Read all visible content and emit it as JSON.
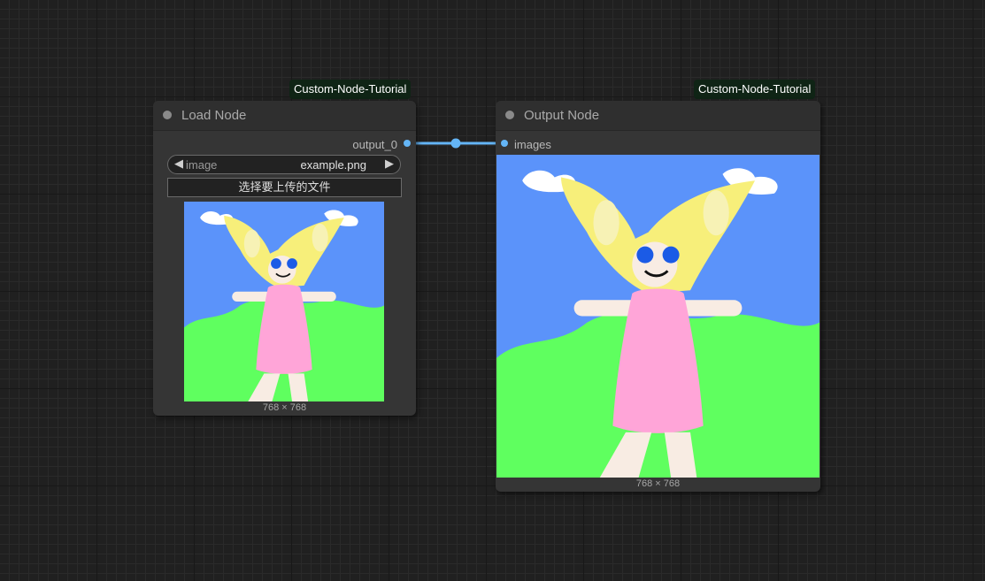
{
  "nodes": {
    "load": {
      "badge": "Custom-Node-Tutorial",
      "title": "Load Node",
      "output_label": "output_0",
      "combo": {
        "name": "image",
        "value": "example.png",
        "prev_arrow": "◀",
        "next_arrow": "▶"
      },
      "upload_button": "选择要上传的文件",
      "image_dims": "768 × 768"
    },
    "output": {
      "badge": "Custom-Node-Tutorial",
      "title": "Output Node",
      "input_label": "images",
      "image_dims": "768 × 768"
    }
  },
  "colors": {
    "link": "#64b5f6",
    "canvas_bg": "#202020",
    "node_bg": "#353535",
    "badge_bg": "#0f2415"
  },
  "icons": {
    "collapse": "circle-dot-icon",
    "slot": "slot-dot-icon",
    "combo_prev": "triangle-left-icon",
    "combo_next": "triangle-right-icon"
  }
}
